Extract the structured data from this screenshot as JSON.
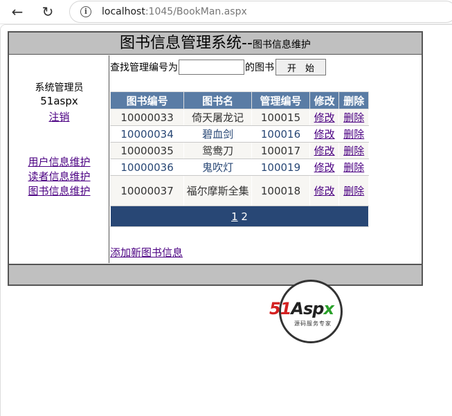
{
  "browser": {
    "url_host": "localhost",
    "url_rest": ":1045/BookMan.aspx"
  },
  "header": {
    "title_main": "图书信息管理系统--",
    "title_sub": "图书信息维护"
  },
  "sidebar": {
    "role": "系统管理员",
    "username": "51aspx",
    "logout": "注销",
    "menu": [
      "用户信息维护",
      "读者信息维护",
      "图书信息维护"
    ]
  },
  "search": {
    "prefix": "查找管理编号为",
    "value": "",
    "suffix": "的图书",
    "button": "开　始"
  },
  "grid": {
    "columns": [
      "图书编号",
      "图书名",
      "管理编号",
      "修改",
      "删除"
    ],
    "rows": [
      {
        "id": "10000033",
        "name": "倚天屠龙记",
        "manage_no": "100015",
        "edit": "修改",
        "delete": "删除"
      },
      {
        "id": "10000034",
        "name": "碧血剑",
        "manage_no": "100016",
        "edit": "修改",
        "delete": "删除"
      },
      {
        "id": "10000035",
        "name": "鸳鸯刀",
        "manage_no": "100017",
        "edit": "修改",
        "delete": "删除"
      },
      {
        "id": "10000036",
        "name": "鬼吹灯",
        "manage_no": "100019",
        "edit": "修改",
        "delete": "删除"
      },
      {
        "id": "10000037",
        "name": "福尔摩斯全集",
        "manage_no": "100018",
        "edit": "修改",
        "delete": "删除"
      }
    ],
    "pager": {
      "current": "1",
      "other": "2"
    }
  },
  "add_link": "添加新图书信息",
  "logo": {
    "brand_51": "51",
    "brand_a": "A",
    "brand_sp": "sp",
    "brand_x": "x",
    "tagline": "源码服务专家"
  }
}
